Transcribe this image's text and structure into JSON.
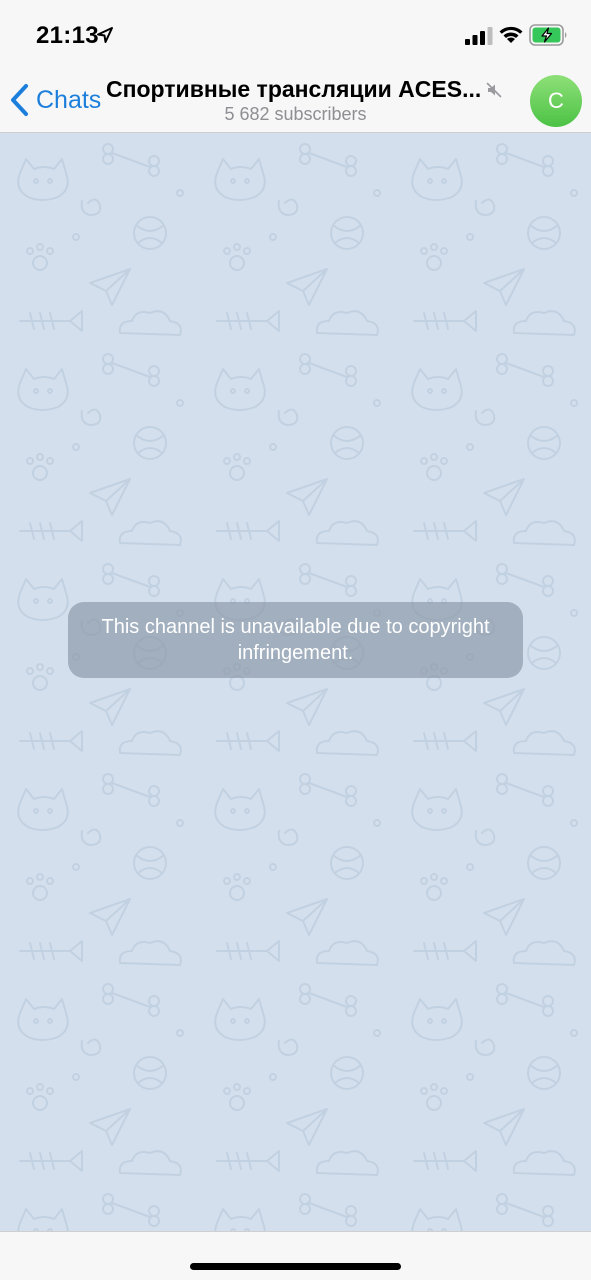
{
  "status_bar": {
    "time": "21:13",
    "icons": [
      "location-arrow-icon",
      "cellular-signal-icon",
      "wifi-icon",
      "battery-charging-icon"
    ],
    "battery_color": "#35c759"
  },
  "header": {
    "back_label": "Chats",
    "title": "Спортивные трансляции ACES...",
    "subtitle": "5 682 subscribers",
    "muted": true,
    "avatar_letter": "C",
    "accent_color": "#1d7fdc",
    "avatar_color": "#4cc245"
  },
  "chat": {
    "wallpaper_color": "#d3dfec",
    "notice": "This channel is unavailable due to copyright infringement."
  }
}
